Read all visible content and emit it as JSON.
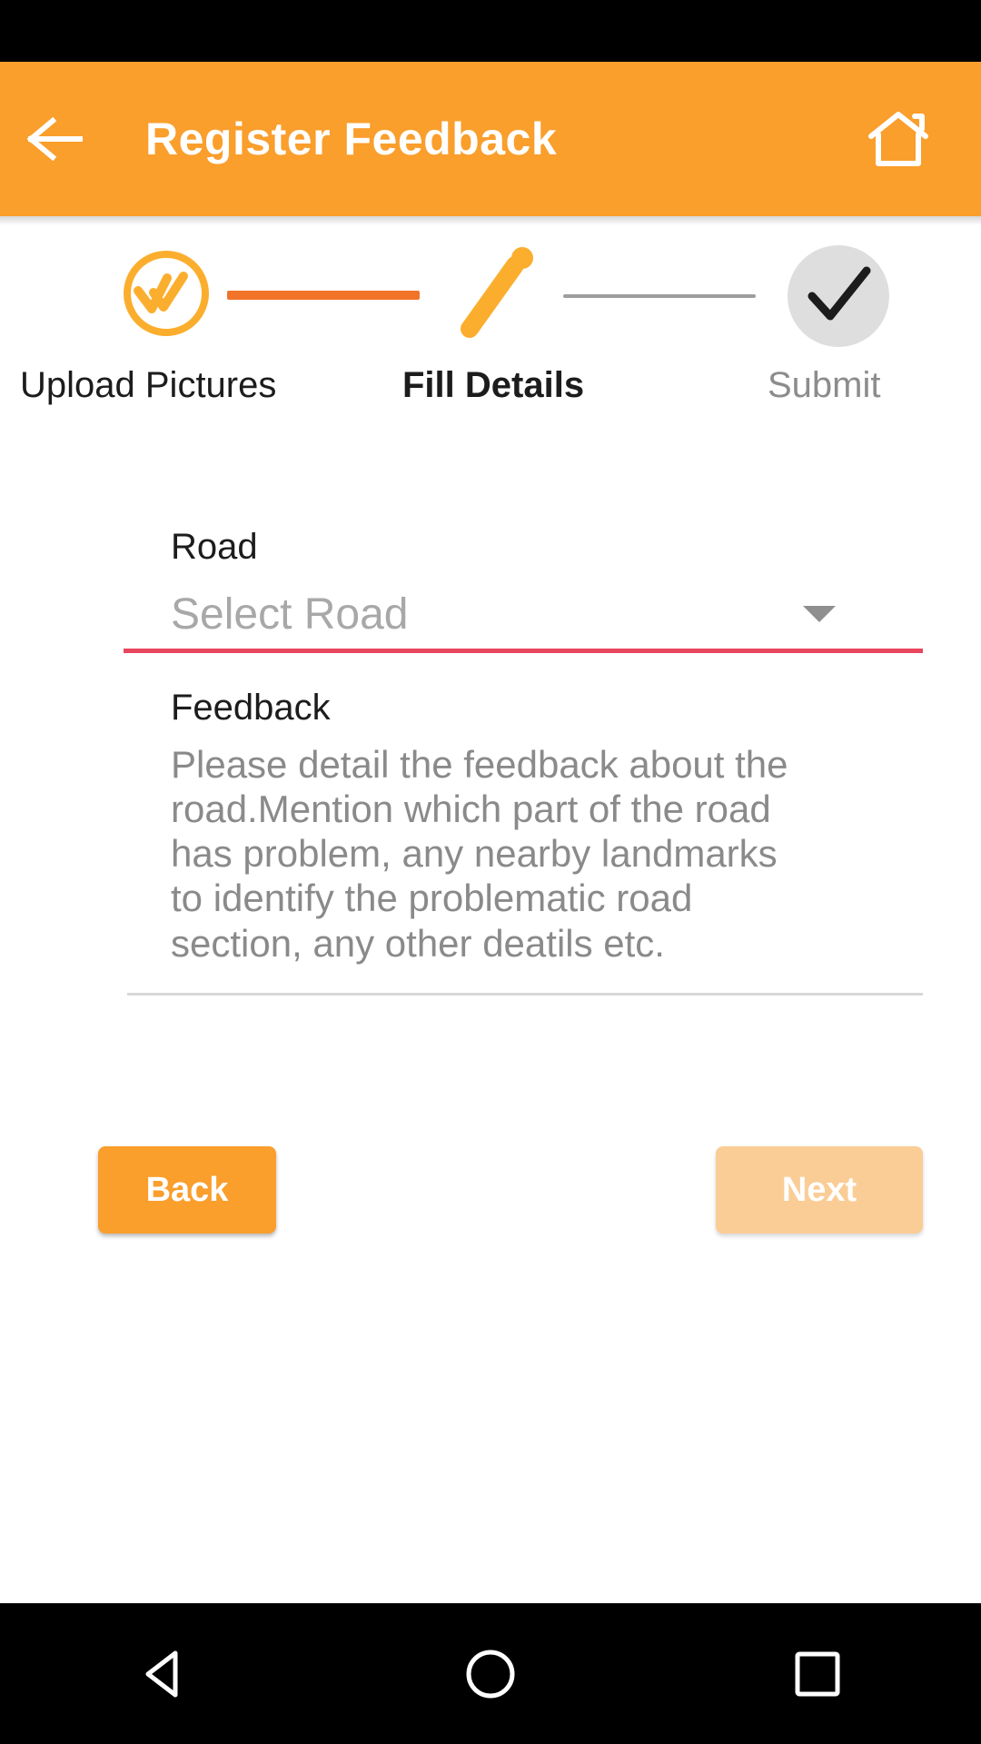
{
  "colors": {
    "app_bar": "#FA9E2C",
    "accent_orange": "#FA9E2C",
    "connector_done": "#F2732A",
    "connector_todo": "#9D9D9D",
    "error_underline": "#E8455E",
    "next_disabled": "#FACD96",
    "placeholder_gray": "#8A8A8A",
    "status_bar": "#000000",
    "nav_bar": "#000000"
  },
  "status_bar": {
    "name": "android-status-bar"
  },
  "app_bar": {
    "title": "Register Feedback",
    "back_icon": "arrow-left-icon",
    "home_icon": "home-icon"
  },
  "stepper": {
    "steps": [
      {
        "label": "Upload Pictures",
        "state": "completed",
        "icon": "double-check-circle-icon"
      },
      {
        "label": "Fill Details",
        "state": "active",
        "icon": "pencil-icon"
      },
      {
        "label": "Submit",
        "state": "pending",
        "icon": "check-circle-icon"
      }
    ],
    "connectors": [
      {
        "state": "completed"
      },
      {
        "state": "pending"
      }
    ]
  },
  "form": {
    "road": {
      "label": "Road",
      "placeholder": "Select Road",
      "value": "",
      "has_error": true,
      "dropdown_icon": "chevron-down-icon"
    },
    "feedback": {
      "label": "Feedback",
      "placeholder": "Please detail the feedback about the road.Mention which part of the road has problem, any nearby landmarks to identify the problematic road section, any other deatils etc.",
      "value": ""
    }
  },
  "actions": {
    "back_label": "Back",
    "next_label": "Next",
    "next_enabled": false
  },
  "nav_bar": {
    "back_icon": "triangle-back-icon",
    "home_icon": "circle-home-icon",
    "recents_icon": "square-recents-icon"
  }
}
